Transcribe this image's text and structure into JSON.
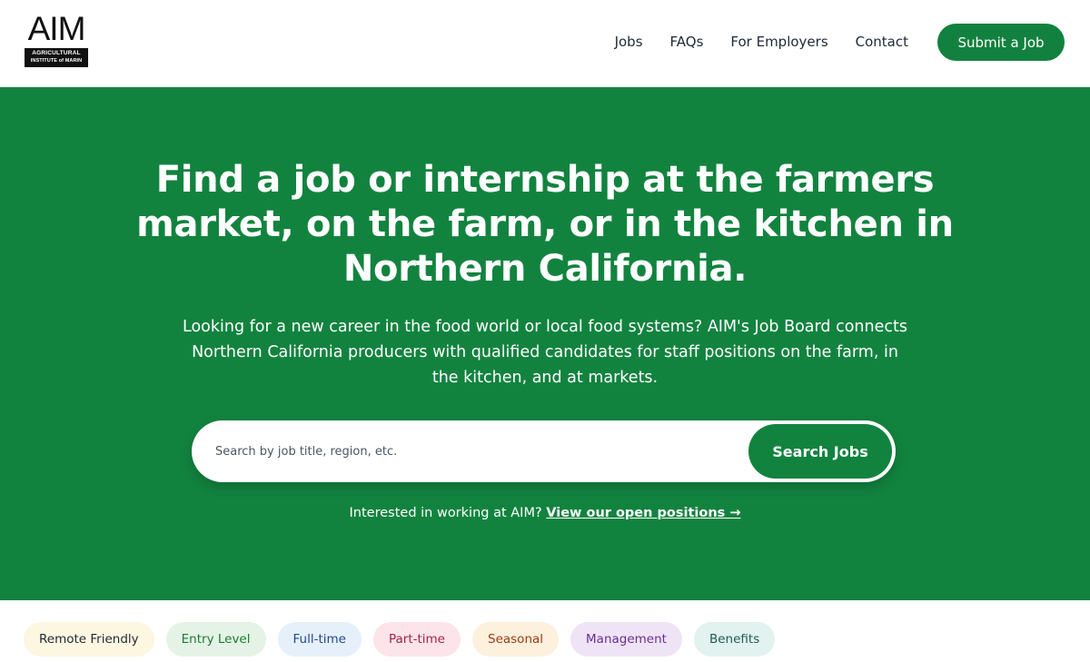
{
  "logo": {
    "word": "AIM",
    "line1": "AGRICULTURAL",
    "line2": "INSTITUTE of MARIN"
  },
  "nav": {
    "items": [
      {
        "label": "Jobs"
      },
      {
        "label": "FAQs"
      },
      {
        "label": "For Employers"
      },
      {
        "label": "Contact"
      }
    ],
    "submit_label": "Submit a Job"
  },
  "hero": {
    "title": "Find a job or internship at the farmers market, on the farm, or in the kitchen in Northern California.",
    "subtitle": "Looking for a new career in the food world or local food systems? AIM's Job Board connects Northern California producers with qualified candidates for staff positions on the farm, in the kitchen, and at markets.",
    "search_placeholder": "Search by job title, region, etc.",
    "search_value": "",
    "search_button": "Search Jobs",
    "interest_text": "Interested in working at AIM?",
    "interest_link": "View our open positions →"
  },
  "tags": [
    {
      "label": "Remote Friendly",
      "bg": "#fdf6e0",
      "fg": "#1f2937"
    },
    {
      "label": "Entry Level",
      "bg": "#e4f3e6",
      "fg": "#1e7a34"
    },
    {
      "label": "Full-time",
      "bg": "#e6f0fb",
      "fg": "#1d4a8c"
    },
    {
      "label": "Part-time",
      "bg": "#fce4ea",
      "fg": "#a3224a"
    },
    {
      "label": "Seasonal",
      "bg": "#fdf0dd",
      "fg": "#9a3d12"
    },
    {
      "label": "Management",
      "bg": "#efe4f6",
      "fg": "#6b2c91"
    },
    {
      "label": "Benefits",
      "bg": "#e2f2ee",
      "fg": "#1f5c55"
    }
  ],
  "colors": {
    "brand_green": "#12833f",
    "button_green": "#12813f",
    "white": "#ffffff"
  }
}
